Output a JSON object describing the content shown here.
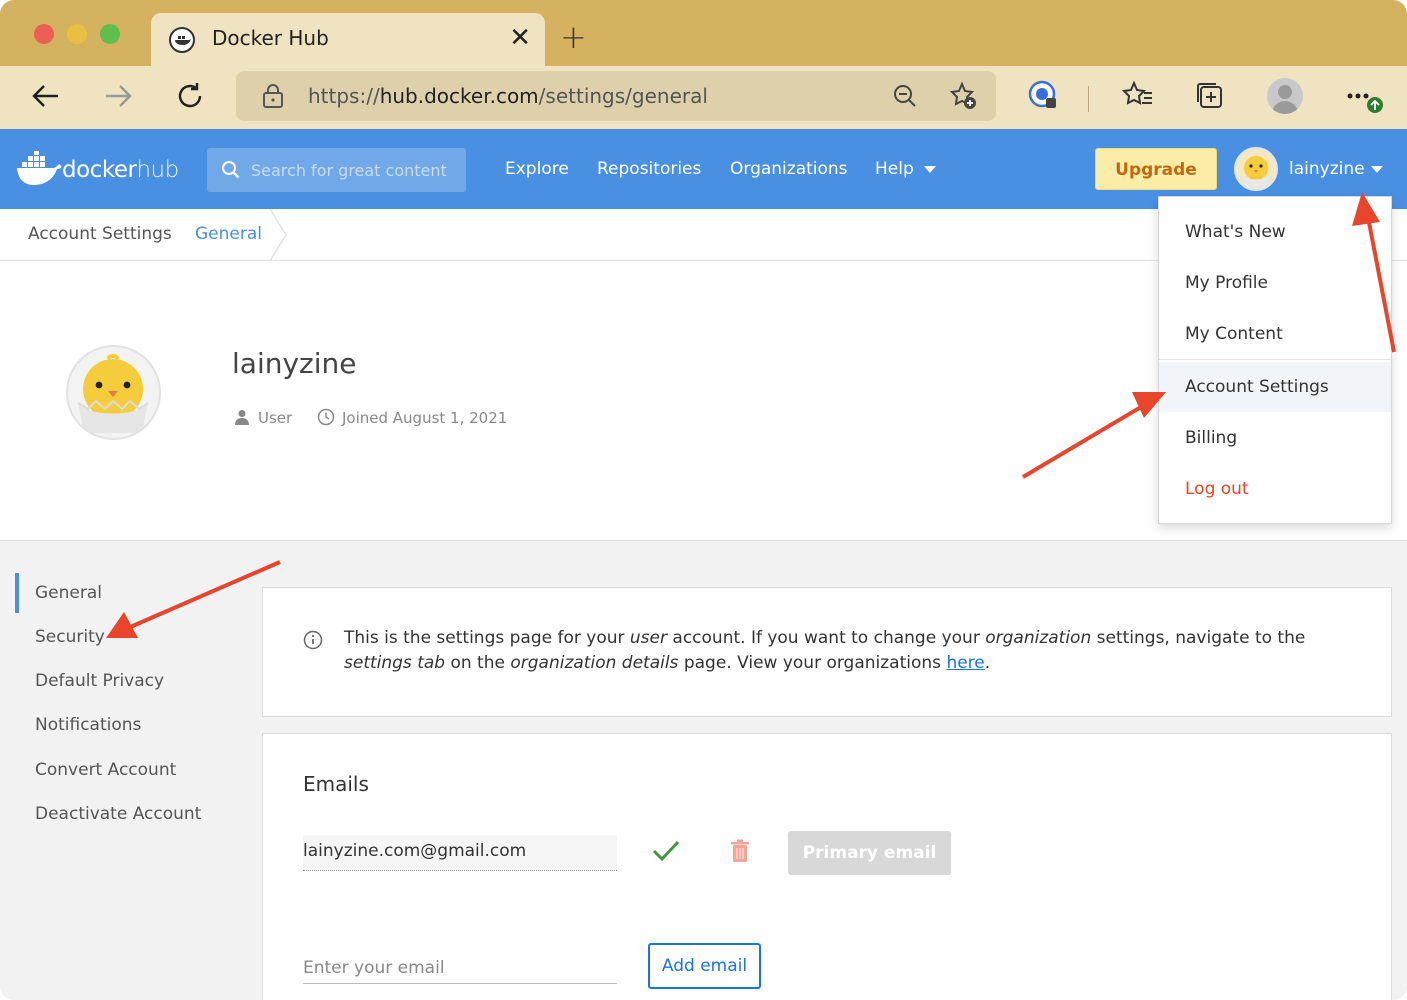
{
  "browser": {
    "tab_title": "Docker Hub",
    "url_prefix": "https://",
    "url_host": "hub.docker.com",
    "url_path": "/settings/general"
  },
  "hub": {
    "logo_docker": "docker",
    "logo_hub": "hub",
    "search_placeholder": "Search for great content",
    "nav": [
      "Explore",
      "Repositories",
      "Organizations",
      "Help"
    ],
    "upgrade_label": "Upgrade",
    "username": "lainyzine"
  },
  "breadcrumb": [
    "Account Settings",
    "General"
  ],
  "profile": {
    "name": "lainyzine",
    "role": "User",
    "joined": "Joined August 1, 2021"
  },
  "sidebar": {
    "items": [
      "General",
      "Security",
      "Default Privacy",
      "Notifications",
      "Convert Account",
      "Deactivate Account"
    ],
    "active": "General"
  },
  "info": {
    "t1": "This is the settings page for your ",
    "i1": "user",
    "t2": " account. If you want to change your ",
    "i2": "organization",
    "t3": " settings, navigate to the ",
    "i3": "settings tab",
    "t4": " on the ",
    "i4": "organization details",
    "t5": " page. View your organizations ",
    "link": "here",
    "t6": "."
  },
  "emails": {
    "title": "Emails",
    "existing": "lainyzine.com@gmail.com",
    "primary_label": "Primary email",
    "new_placeholder": "Enter your email",
    "add_label": "Add email"
  },
  "dropdown": {
    "items": [
      "What's New",
      "My Profile",
      "My Content",
      "Account Settings",
      "Billing",
      "Log out"
    ],
    "highlighted": "Account Settings"
  },
  "colors": {
    "hub_blue": "#4a90e2",
    "upgrade_bg": "#fbeca8",
    "logout_red": "#e2452a",
    "annotation_arrow": "#e8452c"
  }
}
